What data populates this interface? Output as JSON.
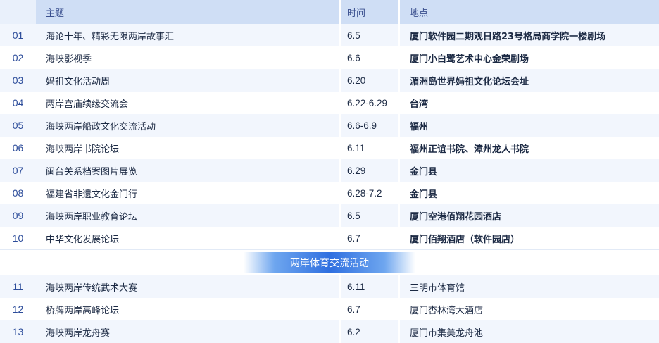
{
  "header": {
    "num": "",
    "subject": "主题",
    "time": "时间",
    "location": "地点"
  },
  "rows_a": [
    {
      "num": "01",
      "subject": "海论十年、精彩无限两岸故事汇",
      "time": "6.5",
      "location": "厦门软件园二期观日路23号格局商学院一楼剧场"
    },
    {
      "num": "02",
      "subject": "海峡影视季",
      "time": "6.6",
      "location": "厦门小白鹭艺术中心金荣剧场"
    },
    {
      "num": "03",
      "subject": "妈祖文化活动周",
      "time": "6.20",
      "location": "湄洲岛世界妈祖文化论坛会址"
    },
    {
      "num": "04",
      "subject": "两岸宫庙续缘交流会",
      "time": "6.22-6.29",
      "location": "台湾"
    },
    {
      "num": "05",
      "subject": "海峡两岸船政文化交流活动",
      "time": "6.6-6.9",
      "location": "福州"
    },
    {
      "num": "06",
      "subject": "海峡两岸书院论坛",
      "time": "6.11",
      "location": "福州正谊书院、漳州龙人书院"
    },
    {
      "num": "07",
      "subject": "闽台关系档案图片展览",
      "time": "6.29",
      "location": "金门县"
    },
    {
      "num": "08",
      "subject": "福建省非遗文化金门行",
      "time": "6.28-7.2",
      "location": "金门县"
    },
    {
      "num": "09",
      "subject": "海峡两岸职业教育论坛",
      "time": "6.5",
      "location": "厦门空港佰翔花园酒店"
    },
    {
      "num": "10",
      "subject": "中华文化发展论坛",
      "time": "6.7",
      "location": "厦门佰翔酒店（软件园店）"
    }
  ],
  "section_title": "两岸体育交流活动",
  "rows_b": [
    {
      "num": "11",
      "subject": "海峡两岸传统武术大赛",
      "time": "6.11",
      "location": "三明市体育馆"
    },
    {
      "num": "12",
      "subject": "桥牌两岸高峰论坛",
      "time": "6.7",
      "location": "厦门杏林湾大酒店"
    },
    {
      "num": "13",
      "subject": "海峡两岸龙舟赛",
      "time": "6.2",
      "location": "厦门市集美龙舟池"
    }
  ],
  "colors": {
    "header_bg": "#cfdef5",
    "row_alt_bg": "#f2f6fd",
    "number_color": "#2c4c9a",
    "banner_blue": "#2f6fe0"
  }
}
